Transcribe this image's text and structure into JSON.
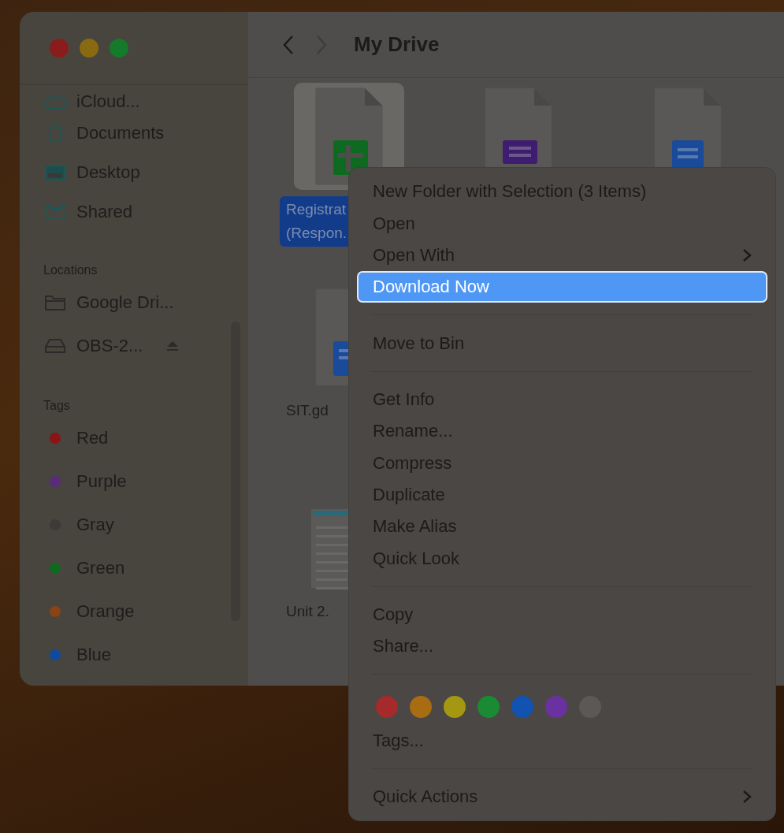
{
  "window": {
    "title": "My Drive",
    "forward_disabled": true
  },
  "sidebar": {
    "sections": [
      {
        "items": [
          {
            "label": "iCloud..."
          },
          {
            "label": "Documents"
          },
          {
            "label": "Desktop"
          },
          {
            "label": "Shared"
          }
        ]
      },
      {
        "heading": "Locations",
        "items": [
          {
            "label": "Google Dri...",
            "ejectable": false
          },
          {
            "label": "OBS-2...",
            "ejectable": true
          }
        ]
      },
      {
        "heading": "Tags",
        "items": [
          {
            "label": "Red",
            "color": "#8c1414"
          },
          {
            "label": "Purple",
            "color": "#5c2a7c"
          },
          {
            "label": "Gray",
            "color": "#3c3b3a"
          },
          {
            "label": "Green",
            "color": "#0e6a20"
          },
          {
            "label": "Orange",
            "color": "#8a4412"
          },
          {
            "label": "Blue",
            "color": "#0f4aa0"
          }
        ]
      }
    ]
  },
  "files": [
    {
      "kind": "sheet",
      "selected": true,
      "label_lines": [
        "Registrat",
        "(Respon."
      ]
    },
    {
      "kind": "form",
      "selected": false
    },
    {
      "kind": "doc",
      "selected": false
    },
    {
      "kind": "doc",
      "selected": false,
      "label_lines": [
        "SIT.gd"
      ]
    },
    {
      "kind": "none"
    },
    {
      "kind": "none"
    },
    {
      "kind": "pdf",
      "selected": false,
      "label_lines": [
        "Unit 2."
      ]
    }
  ],
  "menu": {
    "groups": [
      [
        {
          "kind": "item",
          "label": "New Folder with Selection (3 Items)",
          "selected": false
        },
        {
          "kind": "item",
          "label": "Open",
          "selected": false
        },
        {
          "kind": "item",
          "label": "Open With",
          "selected": false,
          "submenu": true
        },
        {
          "kind": "item",
          "label": "Download Now",
          "selected": true
        }
      ],
      [
        {
          "kind": "item",
          "label": "Move to Bin",
          "selected": false
        }
      ],
      [
        {
          "kind": "item",
          "label": "Get Info",
          "selected": false
        },
        {
          "kind": "item",
          "label": "Rename...",
          "selected": false
        },
        {
          "kind": "item",
          "label": "Compress",
          "selected": false
        },
        {
          "kind": "item",
          "label": "Duplicate",
          "selected": false
        },
        {
          "kind": "item",
          "label": "Make Alias",
          "selected": false
        },
        {
          "kind": "item",
          "label": "Quick Look",
          "selected": false
        }
      ],
      [
        {
          "kind": "item",
          "label": "Copy",
          "selected": false
        },
        {
          "kind": "item",
          "label": "Share...",
          "selected": false
        }
      ],
      [
        {
          "kind": "tags",
          "colors": [
            {
              "color": "#a52a2a"
            },
            {
              "color": "#a86c12"
            },
            {
              "color": "#a49812"
            },
            {
              "color": "#1a8a34"
            },
            {
              "color": "#1252b0"
            },
            {
              "color": "#6a32a0"
            },
            {
              "color": "#5a5958"
            }
          ]
        },
        {
          "kind": "item",
          "label": "Tags...",
          "selected": false
        }
      ],
      [
        {
          "kind": "item",
          "label": "Quick Actions",
          "selected": false,
          "submenu": true
        }
      ]
    ]
  }
}
